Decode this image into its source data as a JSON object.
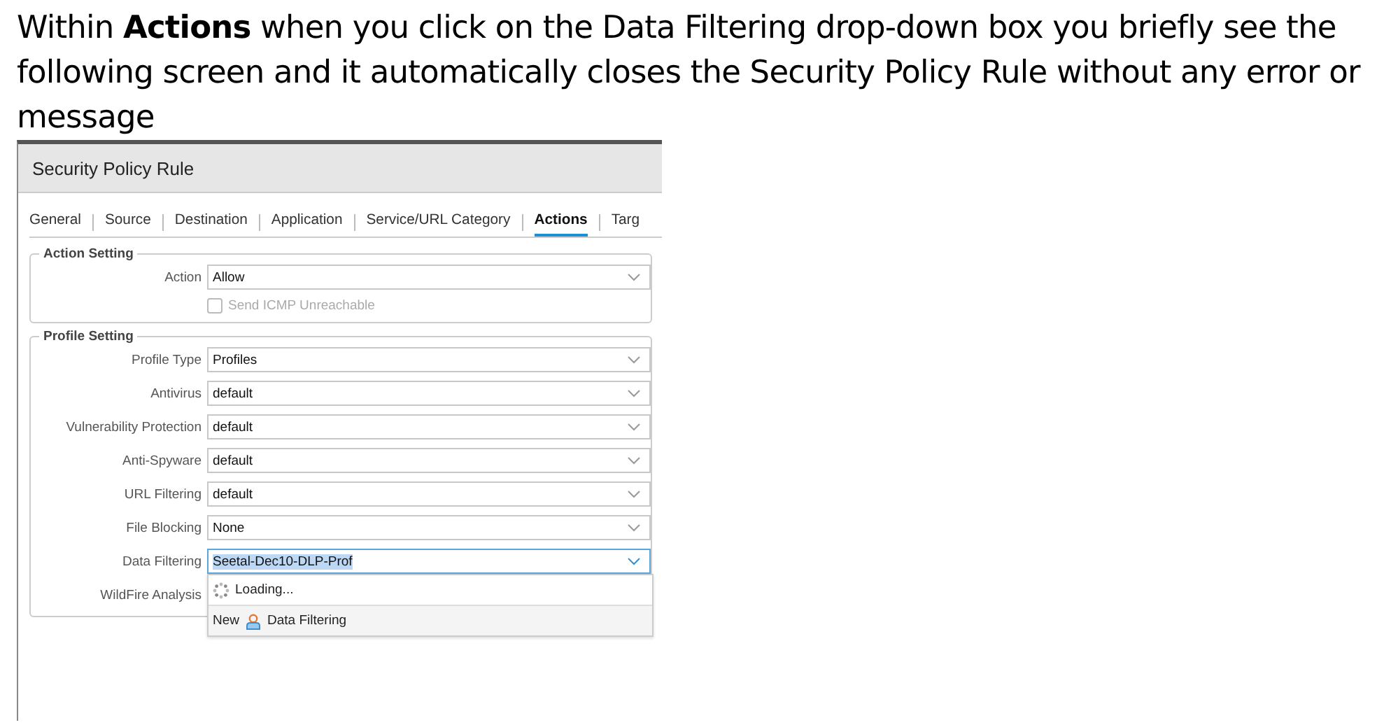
{
  "caption": "Within **Actions** when you click on the Data Filtering drop-down box you briefly see the following screen and it automatically closes the Security Policy Rule without any error or message",
  "window": {
    "title": "Security Policy Rule"
  },
  "tabs": [
    {
      "label": "General",
      "selected": false
    },
    {
      "label": "Source",
      "selected": false
    },
    {
      "label": "Destination",
      "selected": false
    },
    {
      "label": "Application",
      "selected": false
    },
    {
      "label": "Service/URL Category",
      "selected": false
    },
    {
      "label": "Actions",
      "selected": true
    },
    {
      "label": "Targ",
      "selected": false
    }
  ],
  "action_setting": {
    "legend": "Action Setting",
    "fields": [
      {
        "label": "Action",
        "value": "Allow",
        "focused": false
      }
    ],
    "checkbox": {
      "label": "Send ICMP Unreachable",
      "checked": false,
      "disabled": true
    }
  },
  "profile_setting": {
    "legend": "Profile Setting",
    "fields": [
      {
        "label": "Profile Type",
        "value": "Profiles",
        "focused": false
      },
      {
        "label": "Antivirus",
        "value": "default",
        "focused": false
      },
      {
        "label": "Vulnerability Protection",
        "value": "default",
        "focused": false
      },
      {
        "label": "Anti-Spyware",
        "value": "default",
        "focused": false
      },
      {
        "label": "URL Filtering",
        "value": "default",
        "focused": false
      },
      {
        "label": "File Blocking",
        "value": "None",
        "focused": false
      },
      {
        "label": "Data Filtering",
        "value": "Seetal-Dec10-DLP-Prof",
        "focused": true
      },
      {
        "label": "WildFire Analysis"
      }
    ]
  },
  "dropdown": {
    "items": [
      {
        "kind": "loading",
        "label": "Loading..."
      },
      {
        "kind": "new",
        "prefix": "New",
        "label": "Data Filtering"
      }
    ]
  }
}
